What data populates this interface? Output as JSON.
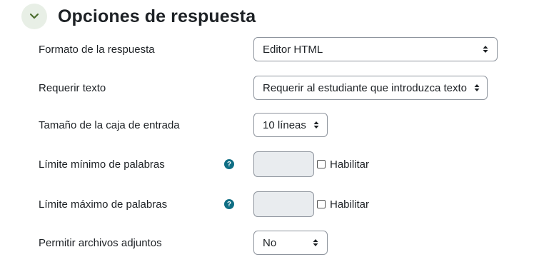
{
  "section": {
    "title": "Opciones de respuesta",
    "collapse_icon": "chevron-down-icon",
    "accent_bg": "#e8efe6",
    "accent_fg": "#4b6c2e"
  },
  "fields": {
    "response_format": {
      "label": "Formato de la respuesta",
      "value": "Editor HTML"
    },
    "require_text": {
      "label": "Requerir texto",
      "value": "Requerir al estudiante que introduzca texto"
    },
    "input_box_size": {
      "label": "Tamaño de la caja de entrada",
      "value": "10 líneas"
    },
    "min_words": {
      "label": "Límite mínimo de palabras",
      "help_icon": "question-circle-icon",
      "value": "",
      "enable_label": "Habilitar",
      "enabled": false
    },
    "max_words": {
      "label": "Límite máximo de palabras",
      "help_icon": "question-circle-icon",
      "value": "",
      "enable_label": "Habilitar",
      "enabled": false
    },
    "allow_attachments": {
      "label": "Permitir archivos adjuntos",
      "value": "No"
    }
  },
  "colors": {
    "help_icon": "#0f6e84",
    "disabled_input_bg": "#e9ecef",
    "border": "#8f959e"
  }
}
